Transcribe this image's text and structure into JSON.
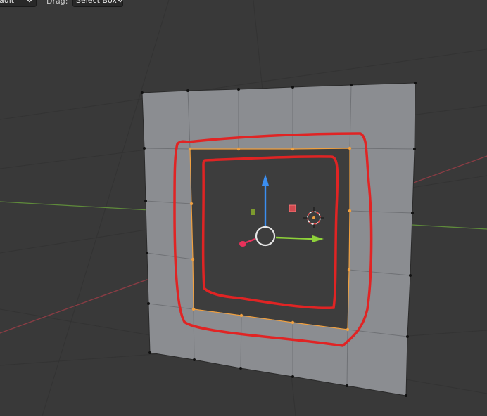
{
  "header": {
    "mode_dropdown_value": "ault",
    "drag_label": "Drag:",
    "drag_dropdown_value": "Select Box"
  },
  "viewport": {
    "background_color": "#393939",
    "grid_color": "#333333",
    "x_axis_color": "#8b3c44",
    "y_axis_color": "#5f8b3b",
    "mesh_face_color": "#8b8d91",
    "selected_face_color": "#3d3d3d",
    "selection_color": "#f0a040",
    "annotation_color": "#e02424",
    "gizmo_colors": {
      "x": "#e8315a",
      "y": "#8ed23a",
      "z": "#3b8ef0",
      "cursor": "#e84a4a"
    }
  }
}
